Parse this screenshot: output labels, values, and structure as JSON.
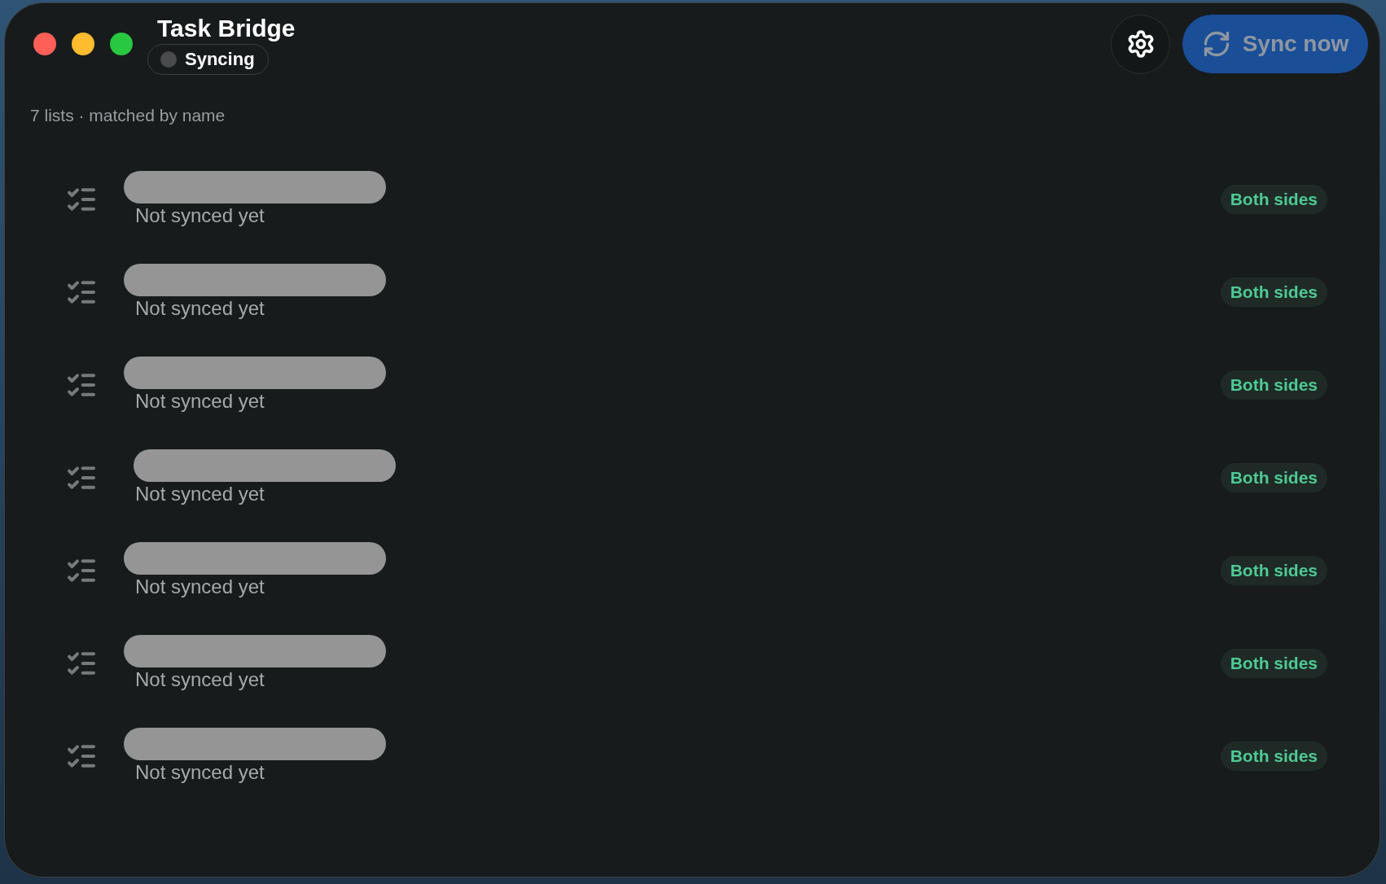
{
  "window": {
    "title": "Task Bridge"
  },
  "status": {
    "label": "Syncing"
  },
  "toolbar": {
    "sync_button": {
      "label": "Sync now",
      "disabled": true
    }
  },
  "summary": "7 lists · matched by name",
  "lists": [
    {
      "status": "Not synced yet",
      "direction": "Both sides"
    },
    {
      "status": "Not synced yet",
      "direction": "Both sides"
    },
    {
      "status": "Not synced yet",
      "direction": "Both sides"
    },
    {
      "status": "Not synced yet",
      "direction": "Both sides"
    },
    {
      "status": "Not synced yet",
      "direction": "Both sides"
    },
    {
      "status": "Not synced yet",
      "direction": "Both sides"
    },
    {
      "status": "Not synced yet",
      "direction": "Both sides"
    }
  ]
}
